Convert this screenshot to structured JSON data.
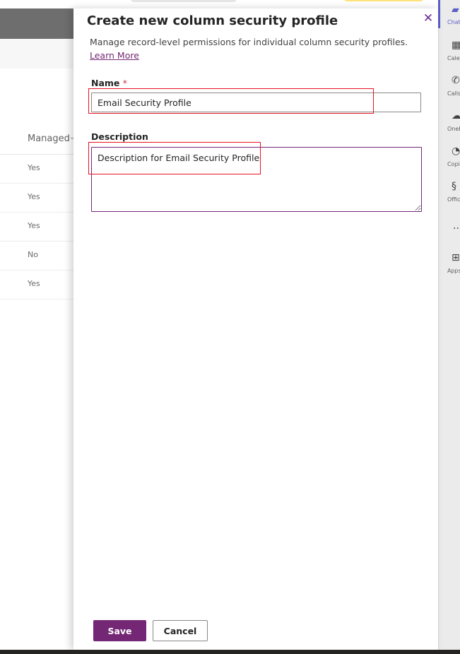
{
  "background": {
    "grid_header": "Managed",
    "rows": [
      "Yes",
      "Yes",
      "Yes",
      "No",
      "Yes"
    ]
  },
  "panel": {
    "title": "Create new column security profile",
    "description": "Manage record-level permissions for individual column security profiles.",
    "learn_more": "Learn More",
    "name_label": "Name",
    "required_marker": "*",
    "name_value": "Email Security Profile",
    "description_label": "Description",
    "description_value": "Description for Email Security Profile",
    "save_label": "Save",
    "cancel_label": "Cancel"
  },
  "rail": {
    "items": [
      {
        "label": "Chat",
        "icon": "chat-icon"
      },
      {
        "label": "Calendar",
        "icon": "calendar-icon"
      },
      {
        "label": "Calls",
        "icon": "phone-icon"
      },
      {
        "label": "OneDrive",
        "icon": "cloud-icon"
      },
      {
        "label": "Copilot",
        "icon": "copilot-icon"
      },
      {
        "label": "Office",
        "icon": "office-icon"
      },
      {
        "label": "Apps",
        "icon": "apps-icon"
      }
    ],
    "more": "..."
  },
  "colors": {
    "accent": "#742774",
    "highlight": "#e81123",
    "rail_active": "#5b5fc7"
  }
}
